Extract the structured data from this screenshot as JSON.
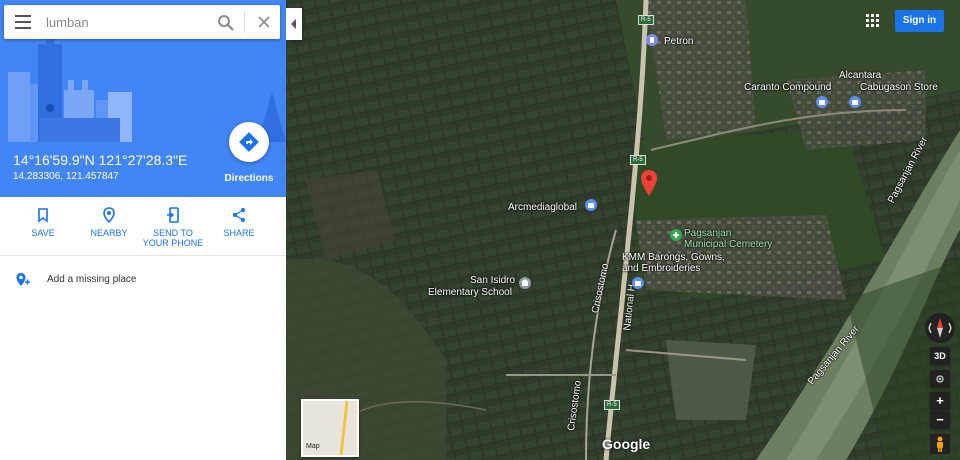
{
  "search": {
    "value": "lumban"
  },
  "place": {
    "coords_dms": "14°16'59.9\"N 121°27'28.3\"E",
    "coords_decimal": "14.283306, 121.457847",
    "directions_label": "Directions"
  },
  "actions": [
    {
      "label": "SAVE",
      "icon": "bookmark-icon"
    },
    {
      "label": "NEARBY",
      "icon": "nearby-icon"
    },
    {
      "label": "SEND TO YOUR PHONE",
      "icon": "send-to-phone-icon"
    },
    {
      "label": "SHARE",
      "icon": "share-icon"
    }
  ],
  "missing_place": {
    "label": "Add a missing place"
  },
  "header": {
    "sign_in": "Sign in"
  },
  "map": {
    "labels": {
      "petron": "Petron",
      "alcantara": "Alcantara",
      "caranto": "Caranto Compound",
      "cabugason": "Cabugason Store",
      "arcmedia": "Arcmediaglobal",
      "pagsanjan_cemetery_1": "Pagsanjan",
      "pagsanjan_cemetery_2": "Municipal Cemetery",
      "kmm_1": "KMM Barongs, Gowns,",
      "kmm_2": "and Embroideries",
      "san_isidro_1": "San Isidro",
      "san_isidro_2": "Elementary School",
      "crisostomo_1": "Crisostomo",
      "crisostomo_2": "Crisostomo",
      "national_hwy": "National H",
      "river_1": "Pagsanjan River",
      "river_2": "Pagsanjan River",
      "r5_1": "R-5",
      "r5_2": "R-5",
      "r5_3": "R-5"
    },
    "minimap_label": "Map",
    "google_logo": "Google",
    "controls": {
      "three_d": "3D",
      "zoom_in": "+",
      "zoom_out": "−"
    },
    "colors": {
      "pin": "#ea4335",
      "accent": "#1a73e8",
      "hero": "#4285f4"
    }
  }
}
